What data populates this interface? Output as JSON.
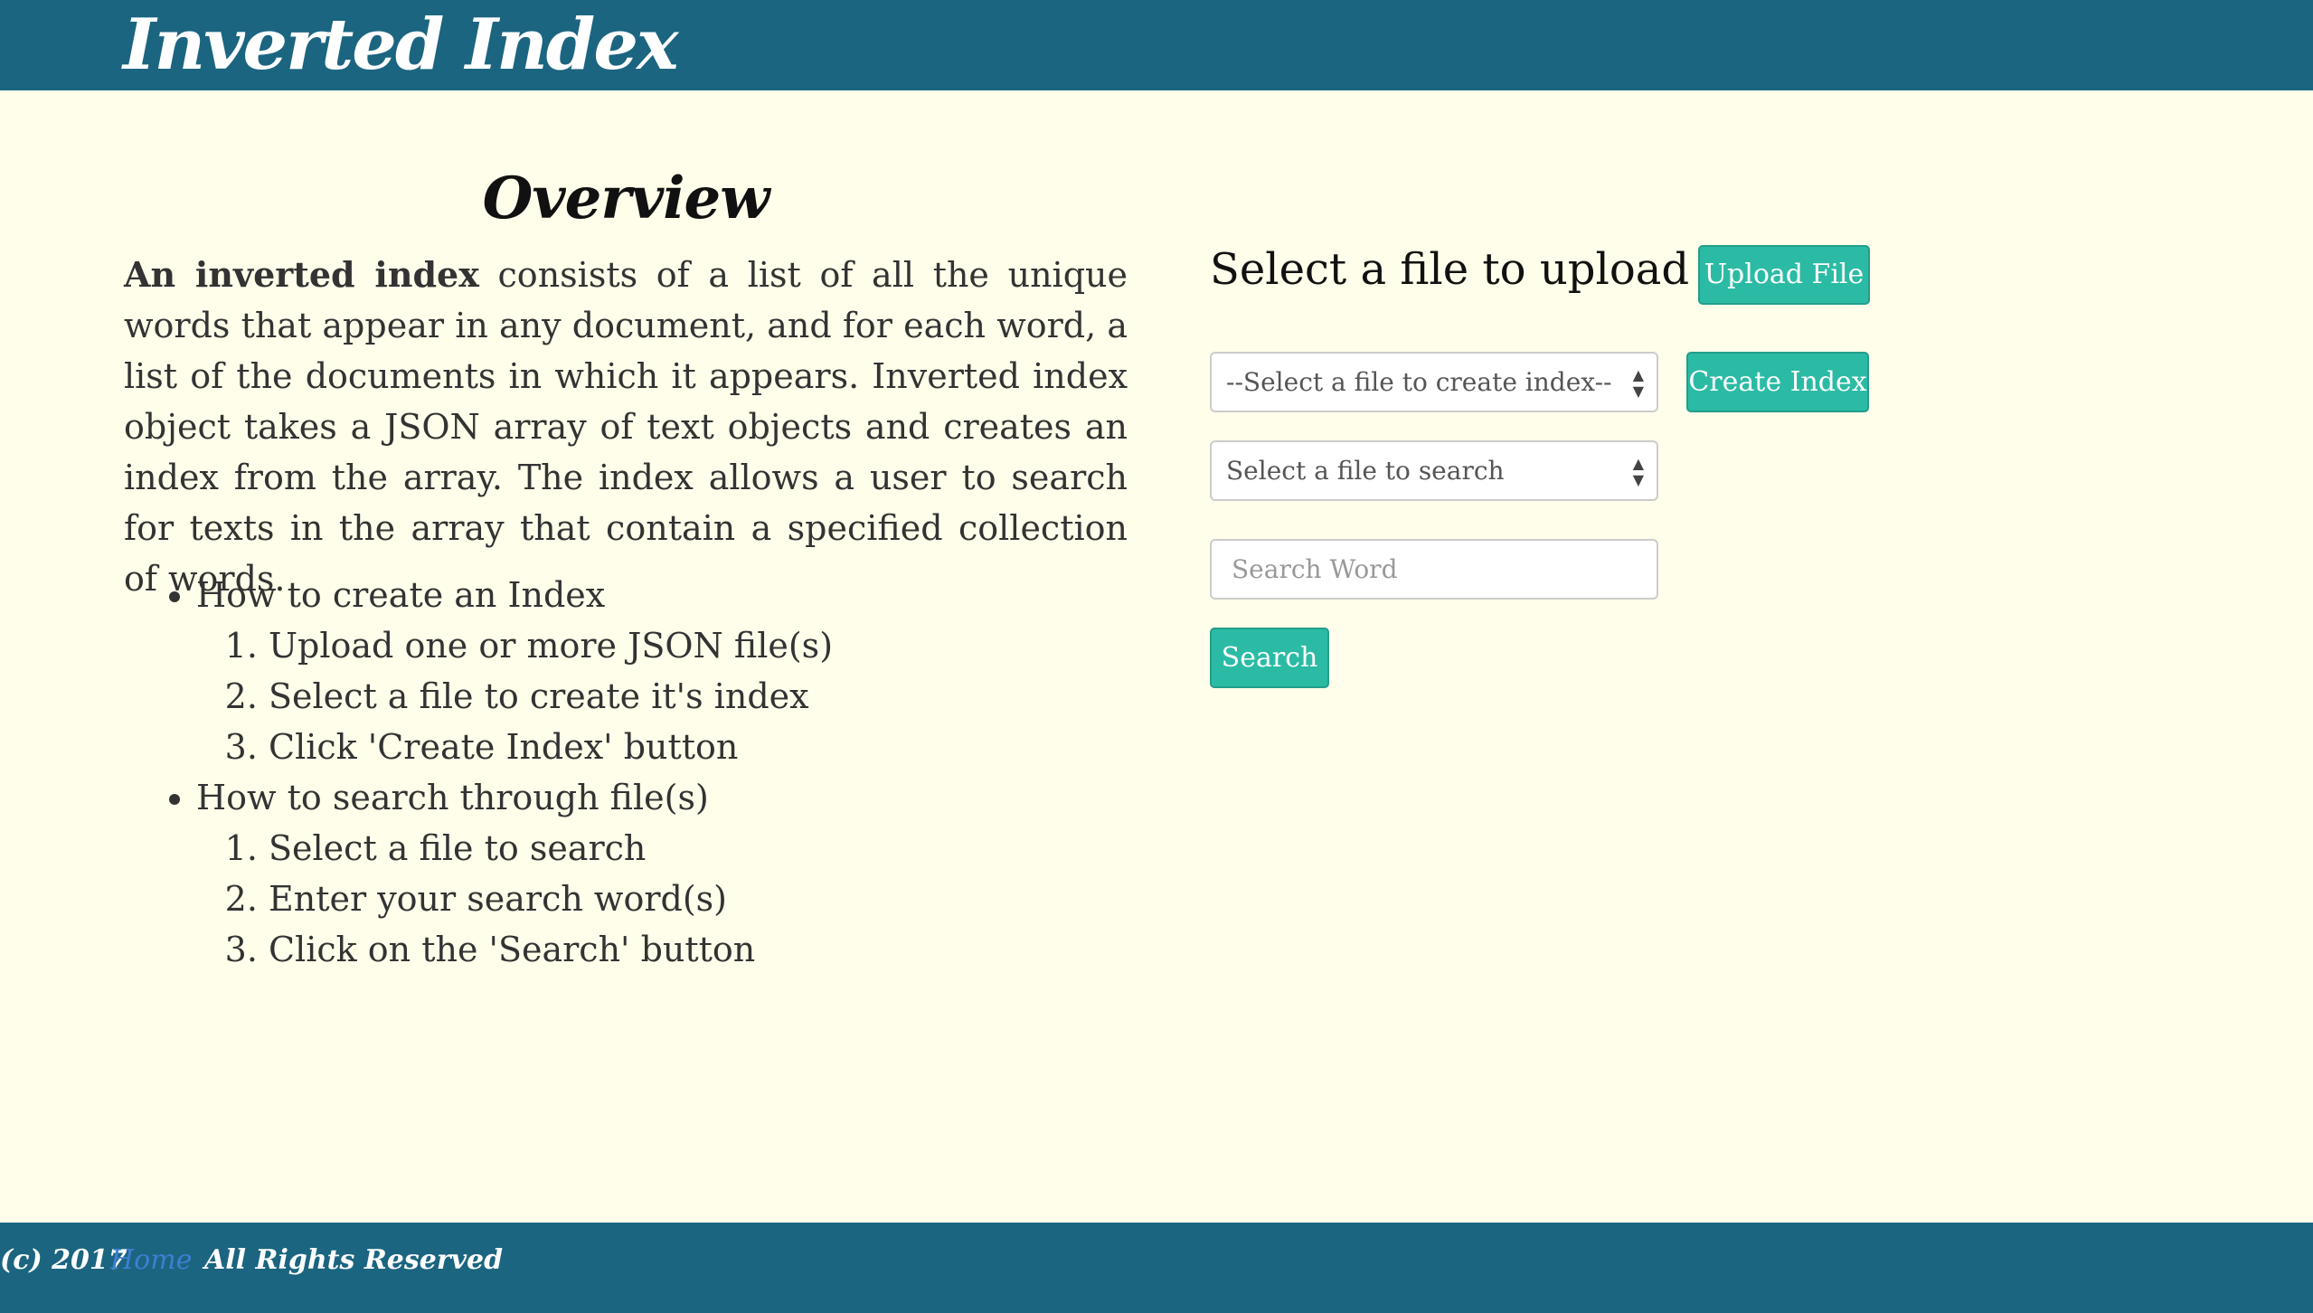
{
  "header": {
    "brand": "Inverted Index"
  },
  "overview": {
    "title": "Overview",
    "intro_bold": "An inverted index",
    "intro_rest": " consists of a list of all the unique words that appear in any document, and for each word, a list of the documents in which it appears. Inverted index object takes a JSON array of text objects and creates an index from the array. The index allows a user to search for texts in the array that contain a specified collection of words.",
    "sections": [
      {
        "heading": "How to create an Index",
        "steps": [
          "Upload one or more JSON file(s)",
          "Select a file to create it's index",
          "Click 'Create Index' button"
        ]
      },
      {
        "heading": "How to search through file(s)",
        "steps": [
          "Select a file to search",
          "Enter your search word(s)",
          "Click on the 'Search' button"
        ]
      }
    ]
  },
  "panel": {
    "title": "Select a file to upload",
    "upload_button": "Upload File",
    "create_select_value": "--Select a file to create index--",
    "create_button": "Create Index",
    "search_select_value": "Select a file to search",
    "search_placeholder": "Search Word",
    "search_button": "Search"
  },
  "footer": {
    "copyright": "(c) 2017",
    "home_link": "Home",
    "rights": "All Rights Reserved"
  },
  "colors": {
    "header_bg": "#1b6580",
    "page_bg": "#fffeea",
    "button_bg": "#2bbba5",
    "link": "#3d7fd3"
  }
}
